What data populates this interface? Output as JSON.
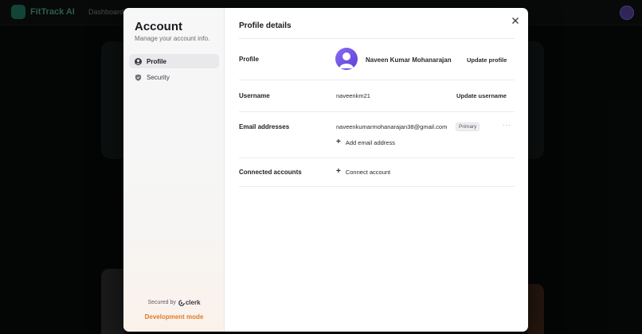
{
  "background": {
    "app_name": "FitTrack AI",
    "nav_link": "Dashboard"
  },
  "sidebar": {
    "title": "Account",
    "subtitle": "Manage your account info.",
    "items": [
      {
        "label": "Profile",
        "icon": "user-circle-icon",
        "active": true
      },
      {
        "label": "Security",
        "icon": "shield-icon",
        "active": false
      }
    ],
    "secured_by": "Secured by",
    "brand": "clerk",
    "dev_mode": "Development mode"
  },
  "content": {
    "title": "Profile details",
    "profile": {
      "label": "Profile",
      "name": "Naveen Kumar Mohanarajan",
      "action": "Update profile"
    },
    "username": {
      "label": "Username",
      "value": "naveenkm21",
      "action": "Update username"
    },
    "email": {
      "label": "Email addresses",
      "value": "naveenkumarmohanarajan38@gmail.com",
      "badge": "Primary",
      "more": "···",
      "add_label": "Add email address"
    },
    "connected": {
      "label": "Connected accounts",
      "add_label": "Connect account"
    }
  },
  "colors": {
    "accent": "#e07b2a",
    "avatar": "#6a4ee6"
  }
}
